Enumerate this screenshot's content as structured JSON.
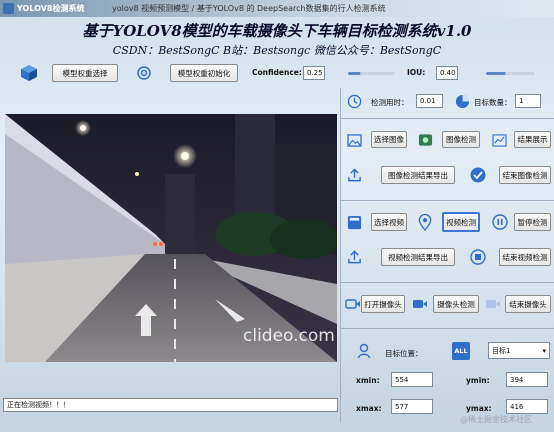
{
  "window": {
    "app_name": "YOLOV8检测系统",
    "title": "yolov8 视频预测模型 / 基于YOLOv8 的 DeepSearch数据集的行人检测系统"
  },
  "header": {
    "title": "基于YOLOV8模型的车载摄像头下车辆目标检测系统v1.0",
    "subtitle": "CSDN：BestSongC   B站：Bestsongc   微信公众号：BestSongC"
  },
  "toolbar": {
    "model_select_label": "模型权重选择",
    "model_init_label": "模型权重初始化",
    "confidence_label": "Confidence:",
    "confidence_value": "0.25",
    "iou_label": "IOU:",
    "iou_value": "0.40",
    "confidence_level": 0.25,
    "iou_level": 0.4
  },
  "stats": {
    "time_label": "检测用时：",
    "time_value": "0.01",
    "count_label": "目标数量：",
    "count_value": "1"
  },
  "image_buttons": {
    "select": "选择图像",
    "detect": "图像检测",
    "show": "结果展示",
    "export": "图像检测结果导出",
    "stop": "结束图像检测"
  },
  "video_buttons": {
    "select": "选择视频",
    "detect": "视频检测",
    "pause": "暂停检测",
    "export": "视频检测结果导出",
    "stop": "结束视频检测"
  },
  "camera_buttons": {
    "open": "打开摄像头",
    "detect": "摄像头检测",
    "stop": "结束摄像头"
  },
  "target": {
    "position_label": "目标位置：",
    "all_badge": "ALL",
    "selected": "目标1",
    "xmin_label": "xmin:",
    "xmin_value": "554",
    "ymin_label": "ymin:",
    "ymin_value": "394",
    "xmax_label": "xmax:",
    "xmax_value": "577",
    "ymax_label": "ymax:",
    "ymax_value": "416"
  },
  "video": {
    "overlay_watermark": "clideo.com"
  },
  "status": {
    "text": "正在检测视频！！！"
  },
  "site_watermark": "@稀土掘金技术社区",
  "colors": {
    "accent": "#3c78d8",
    "icon_blue": "#2f6fc9"
  }
}
